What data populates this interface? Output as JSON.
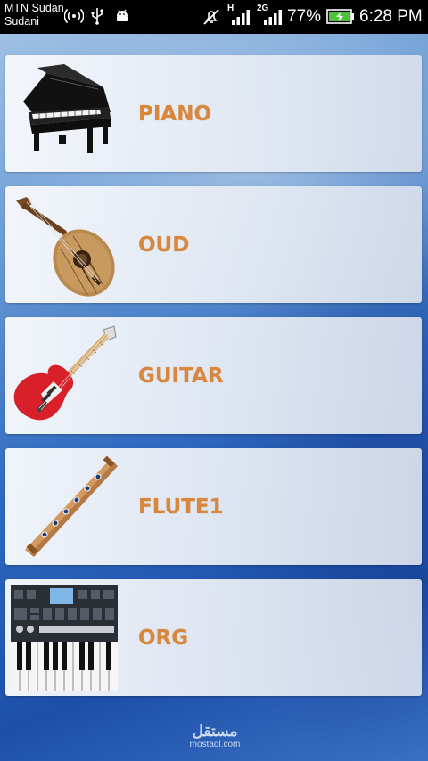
{
  "status_bar": {
    "carrier_line1": "MTN Sudan",
    "carrier_line2": "Sudani",
    "network_label_h": "H",
    "network_label_2g": "2G",
    "battery_percent": "77%",
    "time": "6:28 PM",
    "icons": [
      "hotspot-icon",
      "usb-icon",
      "android-debug-icon",
      "mute-icon",
      "signal-icon",
      "signal-icon",
      "battery-charging-icon"
    ]
  },
  "instruments": [
    {
      "label": "PIANO",
      "icon": "piano-icon"
    },
    {
      "label": "OUD",
      "icon": "oud-icon"
    },
    {
      "label": "GUITAR",
      "icon": "guitar-icon"
    },
    {
      "label": "FLUTE1",
      "icon": "flute-icon"
    },
    {
      "label": "ORG",
      "icon": "organ-keyboard-icon"
    }
  ],
  "watermark": {
    "arabic": "مستقل",
    "latin": "mostaql.com"
  }
}
